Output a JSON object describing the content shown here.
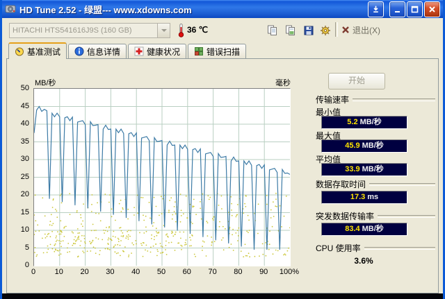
{
  "window": {
    "title": "HD Tune 2.52 - 绿盟--- www.xdowns.com"
  },
  "toolbar": {
    "drive": "HITACHI HTS541616J9S (160 GB)",
    "temp": "36 ℃",
    "exit": "退出(X)"
  },
  "tabs": {
    "benchmark": "基准测试",
    "info": "信息详情",
    "health": "健康状况",
    "error_scan": "错误扫描"
  },
  "chart": {
    "left_unit": "MB/秒",
    "right_unit": "毫秒",
    "y_ticks": [
      50,
      45,
      40,
      35,
      30,
      25,
      20,
      15,
      10,
      5,
      0
    ],
    "x_ticks": [
      "0",
      "10",
      "20",
      "30",
      "40",
      "50",
      "60",
      "70",
      "80",
      "90",
      "100%"
    ]
  },
  "results": {
    "start": "开始",
    "group_transfer": "传输速率",
    "min_label": "最小值",
    "min_value": "5.2",
    "min_unit": "MB/秒",
    "max_label": "最大值",
    "max_value": "45.9",
    "max_unit": "MB/秒",
    "avg_label": "平均值",
    "avg_value": "33.9",
    "avg_unit": "MB/秒",
    "access_label": "数据存取时间",
    "access_value": "17.3",
    "access_unit": "ms",
    "burst_label": "突发数据传输率",
    "burst_value": "83.4",
    "burst_unit": "MB/秒",
    "cpu_label": "CPU 使用率",
    "cpu_value": "3.6%"
  },
  "chart_data": {
    "type": "line+scatter",
    "title": "基准测试",
    "y_left_label": "MB/秒",
    "y_right_label": "毫秒",
    "y_left_range": [
      0,
      50
    ],
    "x_range": [
      0,
      100
    ],
    "grid": true,
    "transfer_rate_series": {
      "name": "transfer-rate",
      "x_step": 1,
      "values": [
        37.5,
        44.0,
        45.0,
        43.6,
        44.2,
        43.8,
        18.9,
        43.1,
        42.1,
        43.1,
        42.1,
        18.0,
        41.8,
        42.1,
        41.0,
        42.0,
        17.1,
        40.6,
        40.8,
        41.0,
        39.9,
        16.2,
        40.7,
        39.6,
        39.7,
        39.9,
        15.3,
        38.6,
        39.7,
        38.5,
        38.6,
        14.4,
        38.6,
        37.6,
        38.6,
        37.4,
        13.5,
        37.3,
        37.6,
        36.5,
        37.5,
        12.6,
        36.1,
        36.3,
        36.5,
        35.4,
        11.7,
        36.2,
        35.1,
        35.2,
        35.4,
        10.8,
        34.1,
        35.2,
        34.0,
        34.1,
        9.9,
        34.1,
        33.1,
        34.1,
        32.9,
        9.0,
        32.8,
        33.1,
        32.0,
        33.0,
        8.1,
        31.6,
        31.8,
        32.0,
        30.9,
        7.2,
        31.7,
        30.6,
        30.7,
        30.9,
        6.3,
        29.6,
        30.7,
        29.5,
        29.6,
        5.4,
        29.6,
        28.6,
        29.6,
        28.4,
        4.5,
        28.3,
        28.6,
        27.5,
        28.5,
        4.5,
        27.1,
        27.3,
        27.5,
        26.4,
        4.5,
        27.2,
        26.1,
        26.2,
        25.8
      ]
    },
    "access_time_scatter": {
      "name": "access-time",
      "seed": 7,
      "count": 330,
      "y_min": 2.5,
      "y_max": 20.5,
      "cluster_count": 140,
      "cluster_x_max": 62,
      "cluster_y_min": 3.5,
      "cluster_y_max": 10
    },
    "stats": {
      "min_mbs": 5.2,
      "max_mbs": 45.9,
      "avg_mbs": 33.9,
      "access_ms": 17.3,
      "burst_mbs": 83.4,
      "cpu_pct": 3.6
    }
  }
}
